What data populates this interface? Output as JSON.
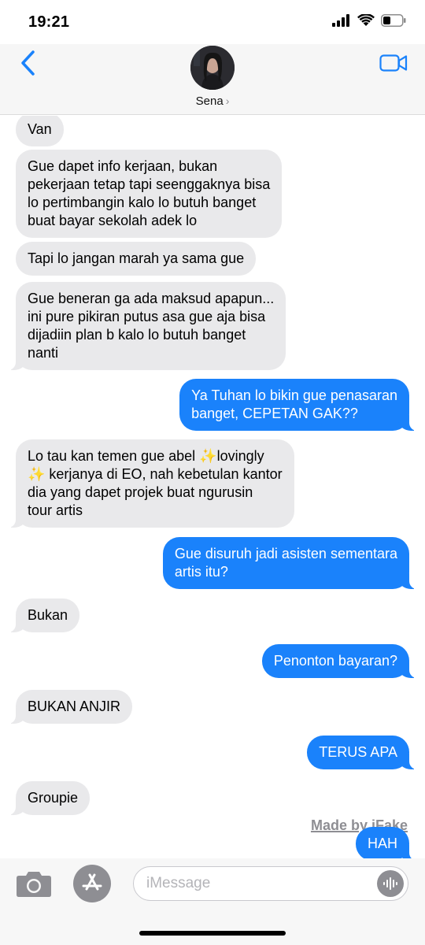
{
  "status_bar": {
    "time": "19:21",
    "icons": [
      "signal-icon",
      "wifi-icon",
      "battery-icon"
    ]
  },
  "header": {
    "contact_name": "Sena",
    "icons": [
      "back-chevron-icon",
      "video-camera-icon"
    ],
    "accent_color": "#1a82fb"
  },
  "messages": [
    {
      "direction": "in",
      "lines": [
        "Van"
      ]
    },
    {
      "direction": "in",
      "lines": [
        "Gue dapet info kerjaan, bukan",
        "pekerjaan tetap tapi seenggaknya bisa",
        "lo pertimbangin kalo lo butuh banget",
        "buat bayar sekolah adek lo"
      ]
    },
    {
      "direction": "in",
      "lines": [
        "Tapi lo jangan marah ya sama gue"
      ]
    },
    {
      "direction": "in",
      "lines": [
        "Gue beneran ga ada maksud apapun...",
        "ini pure pikiran putus asa gue aja bisa",
        "dijadiin plan b kalo lo butuh banget",
        "nanti"
      ]
    },
    {
      "direction": "out",
      "lines": [
        "Ya Tuhan lo bikin gue penasaran",
        "banget, CEPETAN GAK??"
      ]
    },
    {
      "direction": "in",
      "lines": [
        "Lo tau kan temen gue abel ✨lovingly",
        "✨ kerjanya di EO, nah kebetulan kantor",
        "dia yang dapet projek buat ngurusin",
        "tour artis"
      ]
    },
    {
      "direction": "out",
      "lines": [
        "Gue disuruh jadi asisten sementara",
        "artis itu?"
      ]
    },
    {
      "direction": "in",
      "lines": [
        "Bukan"
      ]
    },
    {
      "direction": "out",
      "lines": [
        "Penonton bayaran?"
      ]
    },
    {
      "direction": "in",
      "lines": [
        "BUKAN ANJIR"
      ]
    },
    {
      "direction": "out",
      "lines": [
        "TERUS APA"
      ]
    },
    {
      "direction": "in",
      "lines": [
        "Groupie"
      ]
    },
    {
      "direction": "out",
      "lines": [
        "HAH"
      ]
    }
  ],
  "watermark": "Made by iFake",
  "input_bar": {
    "placeholder": "iMessage",
    "value": "",
    "icons": [
      "camera-icon",
      "app-store-icon",
      "audio-waveform-icon"
    ]
  },
  "colors": {
    "incoming_bubble": "#e9e9eb",
    "outgoing_bubble": "#1a82fb"
  }
}
